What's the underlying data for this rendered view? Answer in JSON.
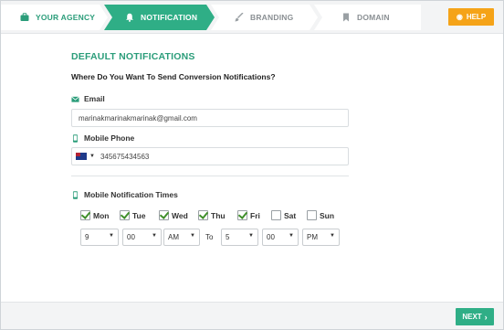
{
  "wizard": {
    "steps": [
      {
        "label": "YOUR AGENCY",
        "icon": "briefcase-icon",
        "state": "completed"
      },
      {
        "label": "NOTIFICATION",
        "icon": "bell-icon",
        "state": "active"
      },
      {
        "label": "BRANDING",
        "icon": "brush-icon",
        "state": "pending"
      },
      {
        "label": "DOMAIN",
        "icon": "bookmark-icon",
        "state": "pending"
      }
    ],
    "help_label": "HELP"
  },
  "main": {
    "section_title": "DEFAULT NOTIFICATIONS",
    "question": "Where Do You Want To Send Conversion Notifications?",
    "email": {
      "label": "Email",
      "value": "marinakmarinakmarinak@gmail.com"
    },
    "phone": {
      "label": "Mobile Phone",
      "value": "345675434563"
    },
    "times": {
      "label": "Mobile Notification Times",
      "days": [
        {
          "label": "Mon",
          "checked": true
        },
        {
          "label": "Tue",
          "checked": true
        },
        {
          "label": "Wed",
          "checked": true
        },
        {
          "label": "Thu",
          "checked": true
        },
        {
          "label": "Fri",
          "checked": true
        },
        {
          "label": "Sat",
          "checked": false
        },
        {
          "label": "Sun",
          "checked": false
        }
      ],
      "from": {
        "hour": "9",
        "minute": "00",
        "ampm": "AM"
      },
      "to_label": "To",
      "to": {
        "hour": "5",
        "minute": "00",
        "ampm": "PM"
      }
    }
  },
  "footer": {
    "next_label": "NEXT"
  },
  "colors": {
    "accent": "#2fae86",
    "help": "#f5a318"
  }
}
